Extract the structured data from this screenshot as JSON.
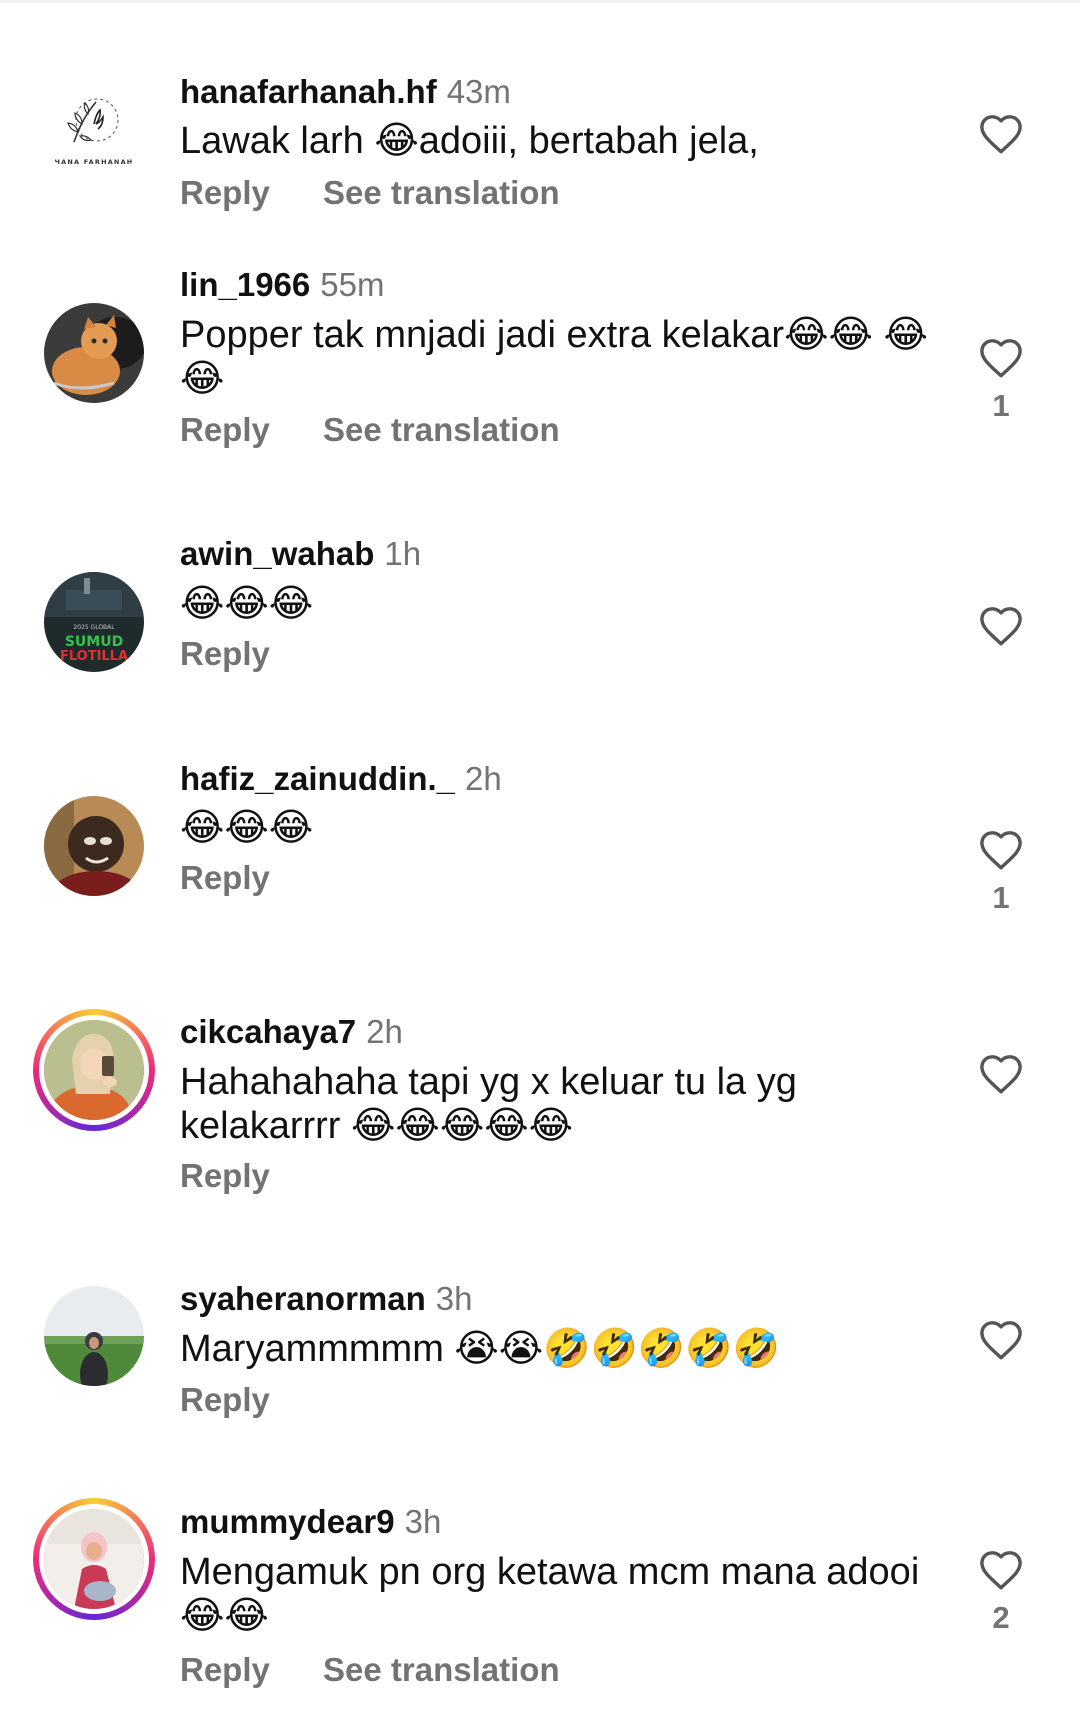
{
  "comments": [
    {
      "username": "hanafarhanah.hf",
      "time": "43m",
      "text": "Lawak larh 😂adoiii, bertabah jela,",
      "reply_label": "Reply",
      "translation_label": "See translation",
      "likes": "",
      "avatar_text": "HANA FARHANAH"
    },
    {
      "username": "lin_1966",
      "time": "55m",
      "text": "Popper tak mnjadi jadi extra kelakar😂😂 😂😂",
      "reply_label": "Reply",
      "translation_label": "See translation",
      "likes": "1"
    },
    {
      "username": "awin_wahab",
      "time": "1h",
      "text": "😂😂😂",
      "reply_label": "Reply",
      "translation_label": "",
      "likes": "",
      "avatar_text": "SUMUD FLOTILLA"
    },
    {
      "username": "hafiz_zainuddin._",
      "time": "2h",
      "text": "😂😂😂",
      "reply_label": "Reply",
      "translation_label": "",
      "likes": "1"
    },
    {
      "username": "cikcahaya7",
      "time": "2h",
      "text": "Hahahahaha tapi yg x keluar tu la yg kelakarrrr 😂😂😂😂😂",
      "reply_label": "Reply",
      "translation_label": "",
      "likes": ""
    },
    {
      "username": "syaheranorman",
      "time": "3h",
      "text": "Maryammmmm 😭😭🤣🤣🤣🤣🤣",
      "reply_label": "Reply",
      "translation_label": "",
      "likes": ""
    },
    {
      "username": "mummydear9",
      "time": "3h",
      "text": "Mengamuk pn org ketawa mcm mana adooi😂😂",
      "reply_label": "Reply",
      "translation_label": "See translation",
      "likes": "2"
    }
  ],
  "icons": {
    "like": "heart-outline-icon"
  },
  "colors": {
    "text": "#111111",
    "secondary": "#737373",
    "story_ring": [
      "#f9ce34",
      "#ee2a7b",
      "#6228d7"
    ]
  }
}
